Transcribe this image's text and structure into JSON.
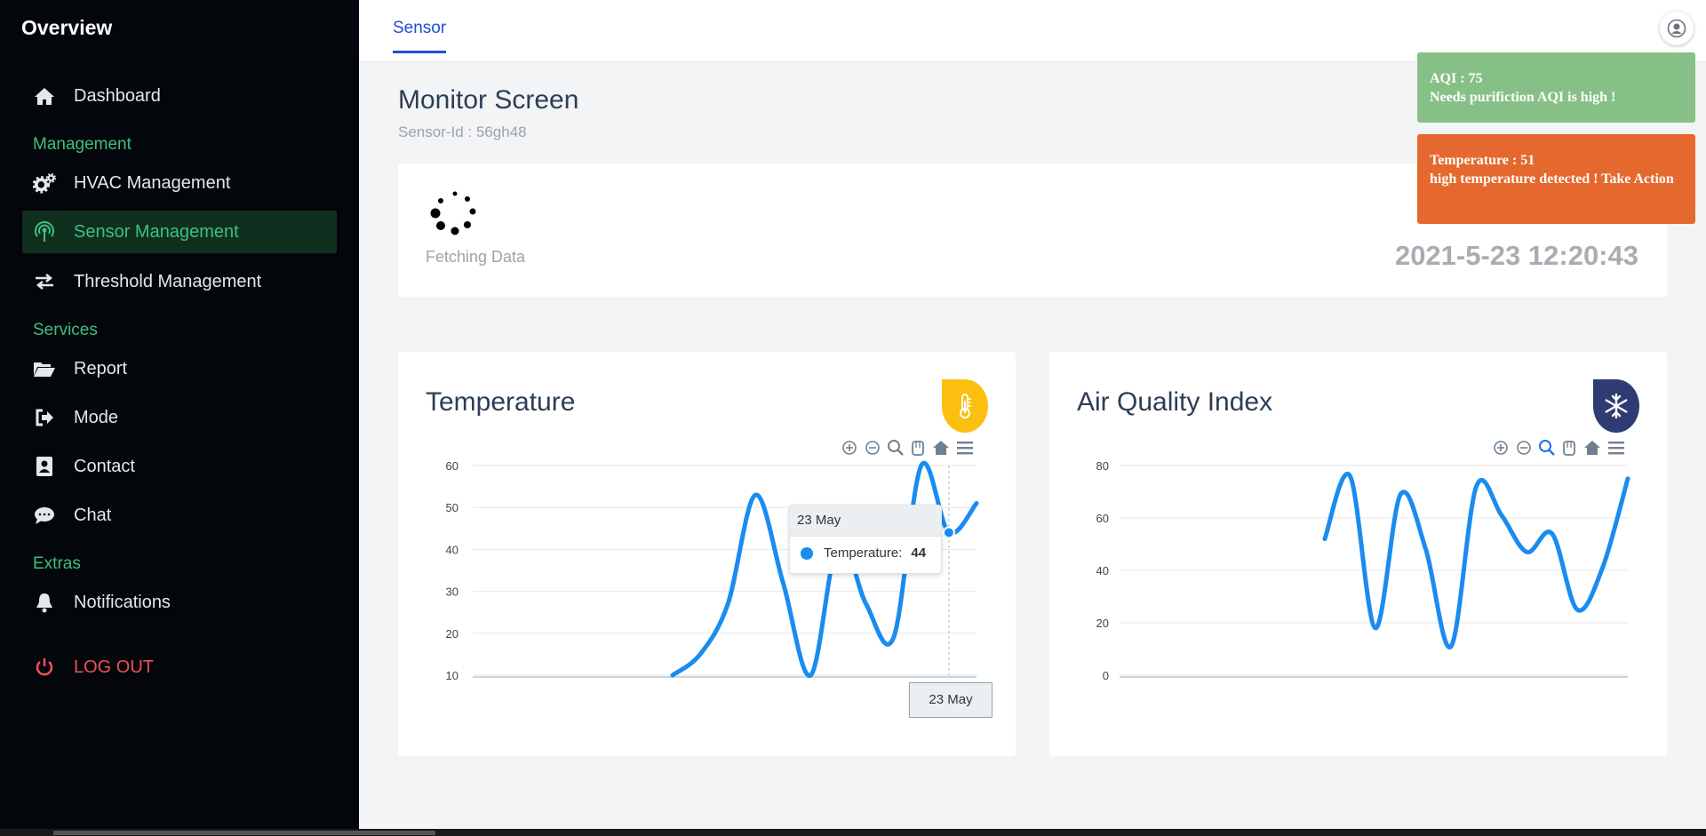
{
  "sidebar": {
    "brand": "Overview",
    "items": {
      "dashboard": "Dashboard",
      "hvac": "HVAC Management",
      "sensor": "Sensor Management",
      "threshold": "Threshold Management",
      "report": "Report",
      "mode": "Mode",
      "contact": "Contact",
      "chat": "Chat",
      "notifications": "Notifications",
      "logout": "LOG OUT"
    },
    "sections": {
      "management": "Management",
      "services": "Services",
      "extras": "Extras"
    },
    "accent": "#3fbf7f",
    "logout_color": "#f0505c"
  },
  "topbar": {
    "tab": "Sensor"
  },
  "header": {
    "title": "Monitor Screen",
    "sensor_id": "Sensor-Id : 56gh48"
  },
  "status": {
    "loading_text": "Fetching Data",
    "datetime": "2021-5-23 12:20:43"
  },
  "toasts": [
    {
      "line1": "AQI : 75",
      "line2": "Needs purifiction AQI is high !",
      "color": "#87c087"
    },
    {
      "line1": "Temperature : 51",
      "line2": "high temperature detected ! Take Action",
      "color": "#e5692f"
    }
  ],
  "charts": {
    "temperature": {
      "title": "Temperature",
      "badge_icon": "thermometer-icon",
      "badge_color": "#fbbf0f"
    },
    "aqi": {
      "title": "Air Quality Index",
      "badge_icon": "snowflake-icon",
      "badge_color": "#2f3b72"
    }
  },
  "tooltip": {
    "date": "23 May",
    "series": "Temperature:",
    "value": "44",
    "x_label": "23 May"
  },
  "chart_data": [
    {
      "type": "line",
      "title": "Temperature",
      "ylim": [
        10,
        60
      ],
      "yticks": [
        "60",
        "50",
        "40",
        "30",
        "20",
        "10"
      ],
      "series": [
        {
          "values": [
            10,
            15,
            27,
            53,
            32,
            10,
            42,
            27,
            19,
            60,
            44,
            51
          ]
        }
      ],
      "color": "#1a8cf0",
      "grid": true
    },
    {
      "type": "line",
      "title": "Air Quality Index",
      "ylim": [
        0,
        80
      ],
      "yticks": [
        "80",
        "60",
        "40",
        "20",
        "0"
      ],
      "series": [
        {
          "values": [
            52,
            76,
            18,
            69,
            48,
            11,
            72,
            61,
            47,
            54,
            25,
            41,
            75
          ]
        }
      ],
      "color": "#1a8cf0",
      "grid": true
    }
  ]
}
